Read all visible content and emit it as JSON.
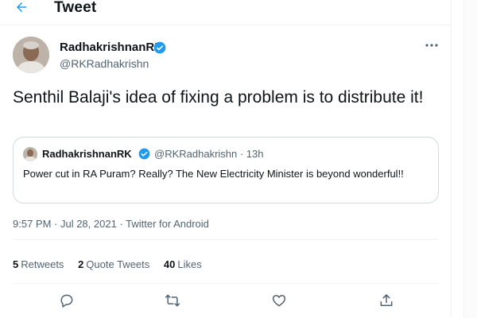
{
  "header": {
    "title": "Tweet"
  },
  "tweet": {
    "author_name": "RadhakrishnanRK",
    "author_handle": "@RKRadhakrishn",
    "text": "Senthil Balaji's idea of fixing a problem is to distribute it!",
    "meta": "9:57 PM · Jul 28, 2021 · Twitter for Android"
  },
  "quote": {
    "author_name": "RadhakrishnanRK",
    "handle_time": "@RKRadhakrishn · 13h",
    "text": "Power cut in RA Puram? Really? The New Electricity Minister is beyond wonderful!!"
  },
  "stats": {
    "retweets_count": "5",
    "retweets_label": "Retweets",
    "quotes_count": "2",
    "quotes_label": "Quote Tweets",
    "likes_count": "40",
    "likes_label": "Likes"
  },
  "colors": {
    "accent": "#1d9bf0",
    "text": "#0f1419",
    "muted": "#536471",
    "border": "#cfd9de"
  },
  "icons": [
    "back-arrow-icon",
    "verified-badge-icon",
    "more-icon",
    "reply-icon",
    "retweet-icon",
    "like-icon",
    "share-icon"
  ]
}
